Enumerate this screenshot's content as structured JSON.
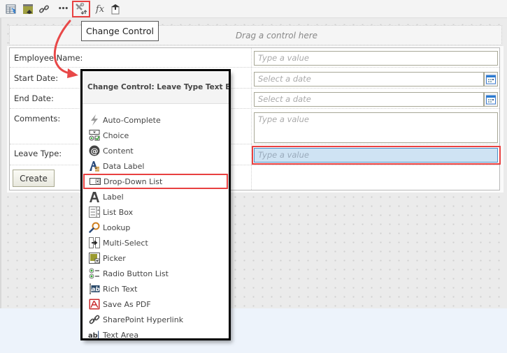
{
  "toolbar": {
    "items": [
      {
        "name": "form-settings-icon"
      },
      {
        "name": "layout-icon"
      },
      {
        "name": "link-icon"
      },
      {
        "name": "more-icon"
      },
      {
        "name": "change-control-icon"
      },
      {
        "name": "formula-icon"
      },
      {
        "name": "publish-icon"
      }
    ],
    "more_label": "•••",
    "formula_label": "fx",
    "tooltip": "Change Control"
  },
  "canvas": {
    "drop_zone_text": "Drag a control here"
  },
  "form": {
    "rows": [
      {
        "label": "Employee Name:",
        "placeholder": "Type a value",
        "type": "text"
      },
      {
        "label": "Start Date:",
        "placeholder": "Select a date",
        "type": "date"
      },
      {
        "label": "End Date:",
        "placeholder": "Select a date",
        "type": "date"
      },
      {
        "label": "Comments:",
        "placeholder": "Type a value",
        "type": "textarea"
      },
      {
        "label": "Leave Type:",
        "placeholder": "Type a value",
        "type": "text",
        "selected": true
      }
    ],
    "create_button": "Create"
  },
  "popup": {
    "title": "Change Control: Leave Type Text Box",
    "items": [
      {
        "label": "Auto-Complete",
        "icon": "lightning-icon"
      },
      {
        "label": "Choice",
        "icon": "choice-icon"
      },
      {
        "label": "Content",
        "icon": "at-sign-icon"
      },
      {
        "label": "Data Label",
        "icon": "data-label-icon"
      },
      {
        "label": "Drop-Down List",
        "icon": "dropdown-icon",
        "highlighted": true
      },
      {
        "label": "Label",
        "icon": "label-icon"
      },
      {
        "label": "List Box",
        "icon": "list-box-icon"
      },
      {
        "label": "Lookup",
        "icon": "magnifier-icon"
      },
      {
        "label": "Multi-Select",
        "icon": "multi-select-icon"
      },
      {
        "label": "Picker",
        "icon": "picker-icon"
      },
      {
        "label": "Radio Button List",
        "icon": "radio-list-icon"
      },
      {
        "label": "Rich Text",
        "icon": "rich-text-icon"
      },
      {
        "label": "Save As PDF",
        "icon": "pdf-icon"
      },
      {
        "label": "SharePoint Hyperlink",
        "icon": "hyperlink-icon"
      },
      {
        "label": "Text Area",
        "icon": "text-area-icon"
      }
    ]
  },
  "colors": {
    "highlight": "#e84040",
    "selected_field_bg": "#cfe3f3",
    "selected_field_border": "#4a90c8"
  }
}
